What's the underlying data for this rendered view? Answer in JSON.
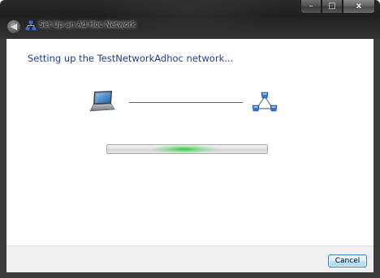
{
  "window": {
    "title": "Set Up an Ad Hoc Network",
    "caption_minimize": "–",
    "caption_maximize": "□",
    "caption_close": "x",
    "back_glyph": "◀"
  },
  "content": {
    "heading": "Setting up the TestNetworkAdhoc network...",
    "left_icon": "laptop-icon",
    "right_icon": "adhoc-network-icon",
    "progress": {
      "style": "indeterminate-marquee",
      "color": "#28c83c"
    }
  },
  "footer": {
    "cancel_label": "Cancel"
  },
  "colors": {
    "heading": "#1e3f8a",
    "frame": "#2a2a2a",
    "button_border": "#3c7fb1"
  }
}
